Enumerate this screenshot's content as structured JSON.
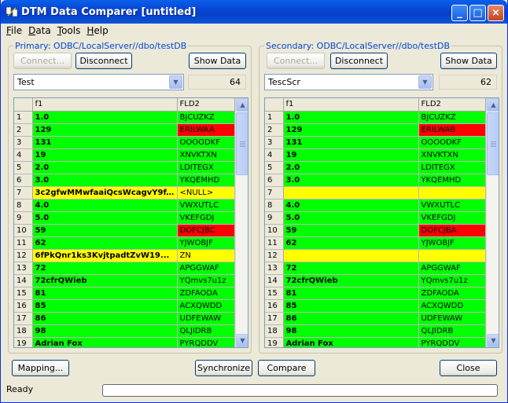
{
  "window": {
    "title": "DTM Data Comparer [untitled]",
    "minimize": "_",
    "maximize": "□",
    "close": "×"
  },
  "menu": [
    "File",
    "Data",
    "Tools",
    "Help"
  ],
  "primary": {
    "label": "Primary: ODBC/LocalServer//dbo/testDB",
    "connect": "Connect...",
    "disconnect": "Disconnect",
    "show_data": "Show Data",
    "table": "Test",
    "count": "64",
    "columns": [
      "f1",
      "FLD2"
    ],
    "rows": [
      {
        "n": "1",
        "f1": "1.0",
        "fld2": "BJCUZKZ",
        "c1": "green",
        "c2": "green"
      },
      {
        "n": "2",
        "f1": "129",
        "fld2": "ERILWAA",
        "c1": "green",
        "c2": "red"
      },
      {
        "n": "3",
        "f1": "131",
        "fld2": "OOOODKF",
        "c1": "green",
        "c2": "green"
      },
      {
        "n": "4",
        "f1": "19",
        "fld2": "XNVKTXN",
        "c1": "green",
        "c2": "green"
      },
      {
        "n": "5",
        "f1": "2.0",
        "fld2": "LDITEGX",
        "c1": "green",
        "c2": "green"
      },
      {
        "n": "6",
        "f1": "3.0",
        "fld2": "YKQEMHD",
        "c1": "green",
        "c2": "green"
      },
      {
        "n": "7",
        "f1": "3c2gfwMMwfaaiQcsWcagvY9f...",
        "fld2": "<NULL>",
        "c1": "yellow",
        "c2": "yellow"
      },
      {
        "n": "8",
        "f1": "4.0",
        "fld2": "VWXUTLC",
        "c1": "green",
        "c2": "green"
      },
      {
        "n": "9",
        "f1": "5.0",
        "fld2": "VKEFGDJ",
        "c1": "green",
        "c2": "green"
      },
      {
        "n": "10",
        "f1": "59",
        "fld2": "DOFCJBC",
        "c1": "green",
        "c2": "red"
      },
      {
        "n": "11",
        "f1": "62",
        "fld2": "YJWOBJF",
        "c1": "green",
        "c2": "green"
      },
      {
        "n": "12",
        "f1": "6fPkQnr1ks3KvjtpadtZvW19...",
        "fld2": "ZN",
        "c1": "yellow",
        "c2": "yellow"
      },
      {
        "n": "13",
        "f1": "72",
        "fld2": "APGGWAF",
        "c1": "green",
        "c2": "green"
      },
      {
        "n": "14",
        "f1": "72cfrQWieb",
        "fld2": "YQmvs7u1z",
        "c1": "green",
        "c2": "green"
      },
      {
        "n": "15",
        "f1": "81",
        "fld2": "ZDFAODA",
        "c1": "green",
        "c2": "green"
      },
      {
        "n": "16",
        "f1": "85",
        "fld2": "ACXQWDD",
        "c1": "green",
        "c2": "green"
      },
      {
        "n": "17",
        "f1": "86",
        "fld2": "UDFEWAW",
        "c1": "green",
        "c2": "green"
      },
      {
        "n": "18",
        "f1": "98",
        "fld2": "QLJIDRB",
        "c1": "green",
        "c2": "green"
      },
      {
        "n": "19",
        "f1": "Adrian Fox",
        "fld2": "PYRQDDV",
        "c1": "green",
        "c2": "green"
      }
    ]
  },
  "secondary": {
    "label": "Secondary: ODBC/LocalServer//dbo/testDB",
    "connect": "Connect...",
    "disconnect": "Disconnect",
    "show_data": "Show Data",
    "table": "TescScr",
    "count": "62",
    "columns": [
      "f1",
      "FLD2"
    ],
    "rows": [
      {
        "n": "1",
        "f1": "1.0",
        "fld2": "BJCUZKZ",
        "c1": "green",
        "c2": "green"
      },
      {
        "n": "2",
        "f1": "129",
        "fld2": "ERILWAB",
        "c1": "green",
        "c2": "red"
      },
      {
        "n": "3",
        "f1": "131",
        "fld2": "OOOODKF",
        "c1": "green",
        "c2": "green"
      },
      {
        "n": "4",
        "f1": "19",
        "fld2": "XNVKTXN",
        "c1": "green",
        "c2": "green"
      },
      {
        "n": "5",
        "f1": "2.0",
        "fld2": "LDITEGX",
        "c1": "green",
        "c2": "green"
      },
      {
        "n": "6",
        "f1": "3.0",
        "fld2": "YKQEMHD",
        "c1": "green",
        "c2": "green"
      },
      {
        "n": "7",
        "f1": "",
        "fld2": "",
        "c1": "yellow",
        "c2": "yellow"
      },
      {
        "n": "8",
        "f1": "4.0",
        "fld2": "VWXUTLC",
        "c1": "green",
        "c2": "green"
      },
      {
        "n": "9",
        "f1": "5.0",
        "fld2": "VKEFGDJ",
        "c1": "green",
        "c2": "green"
      },
      {
        "n": "10",
        "f1": "59",
        "fld2": "DOFCJBA",
        "c1": "green",
        "c2": "red"
      },
      {
        "n": "11",
        "f1": "62",
        "fld2": "YJWOBJF",
        "c1": "green",
        "c2": "green"
      },
      {
        "n": "12",
        "f1": "",
        "fld2": "",
        "c1": "yellow",
        "c2": "yellow"
      },
      {
        "n": "13",
        "f1": "72",
        "fld2": "APGGWAF",
        "c1": "green",
        "c2": "green"
      },
      {
        "n": "14",
        "f1": "72cfrQWieb",
        "fld2": "YQmvs7u1z",
        "c1": "green",
        "c2": "green"
      },
      {
        "n": "15",
        "f1": "81",
        "fld2": "ZDFAODA",
        "c1": "green",
        "c2": "green"
      },
      {
        "n": "16",
        "f1": "85",
        "fld2": "ACXQWDD",
        "c1": "green",
        "c2": "green"
      },
      {
        "n": "17",
        "f1": "86",
        "fld2": "UDFEWAW",
        "c1": "green",
        "c2": "green"
      },
      {
        "n": "18",
        "f1": "98",
        "fld2": "QLJIDRB",
        "c1": "green",
        "c2": "green"
      },
      {
        "n": "19",
        "f1": "Adrian Fox",
        "fld2": "PYRQDDV",
        "c1": "green",
        "c2": "green"
      }
    ]
  },
  "footer": {
    "mapping": "Mapping...",
    "synchronize": "Synchronize",
    "compare": "Compare",
    "close": "Close"
  },
  "status": {
    "text": "Ready",
    "progress": 0
  },
  "colors": {
    "green": "#00ff00",
    "red": "#ff0000",
    "yellow": "#ffff00"
  }
}
